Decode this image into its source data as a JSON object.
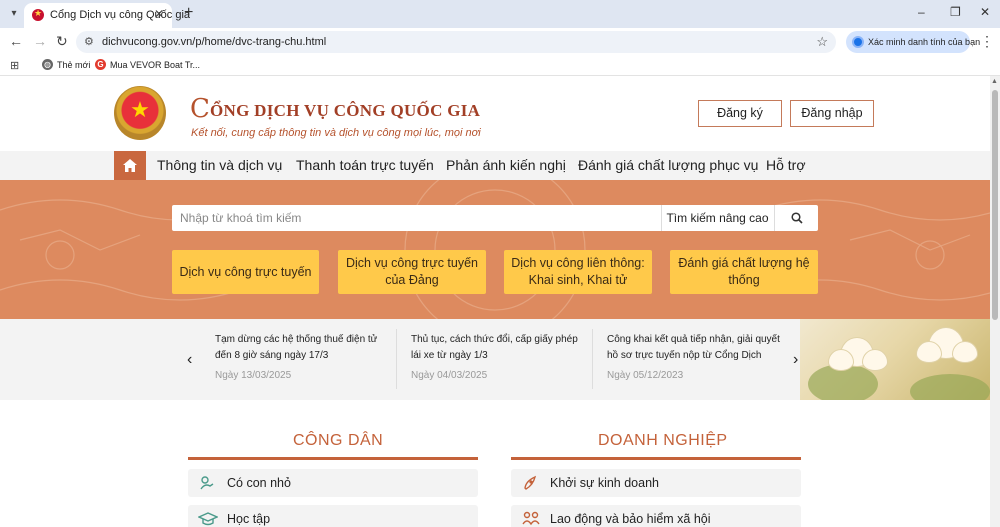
{
  "browser": {
    "tab_title": "Cổng Dịch vụ công Quốc gia",
    "tab_close": "✕",
    "new_tab": "+",
    "url": "dichvucong.gov.vn/p/home/dvc-trang-chu.html",
    "identity_chip": "Xác minh danh tính của bạn",
    "bookmarks": [
      {
        "label": "Thẻ mới",
        "icon": "globe-icon"
      },
      {
        "label": "Mua VEVOR Boat Tr...",
        "icon": "g-icon"
      }
    ],
    "window_controls": [
      "–",
      "❐",
      "✕"
    ]
  },
  "header": {
    "brand_mark": "C",
    "title": "ỔNG DỊCH VỤ CÔNG QUỐC GIA",
    "subtitle": "Kết nối, cung cấp thông tin và dịch vụ công mọi lúc, mọi nơi",
    "register_label": "Đăng ký",
    "login_label": "Đăng nhập"
  },
  "nav": {
    "items": [
      "Thông tin và dịch vụ",
      "Thanh toán trực tuyến",
      "Phản ánh kiến nghị",
      "Đánh giá chất lượng phục vụ",
      "Hỗ trợ"
    ]
  },
  "search": {
    "placeholder": "Nhập từ khoá tìm kiếm",
    "advanced_label": "Tìm kiếm nâng cao"
  },
  "quick_links": [
    "Dịch vụ công trực tuyến",
    "Dịch vụ công trực tuyến của Đảng",
    "Dịch vụ công liên thông: Khai sinh, Khai tử",
    "Đánh giá chất lượng hệ thống"
  ],
  "news": [
    {
      "text": "Tạm dừng các hệ thống thuế điện tử đến 8 giờ sáng ngày 17/3",
      "date": "Ngày 13/03/2025"
    },
    {
      "text": "Thủ tục, cách thức đổi, cấp giấy phép lái xe từ ngày 1/3",
      "date": "Ngày 04/03/2025"
    },
    {
      "text": "Công khai kết quả tiếp nhận, giải quyết hồ sơ trực tuyến nộp từ Cổng Dịch vụ...",
      "date": "Ngày 05/12/2023"
    }
  ],
  "sections": {
    "citizen": {
      "title": "CÔNG DÂN",
      "items": [
        "Có con nhỏ",
        "Học tập"
      ]
    },
    "business": {
      "title": "DOANH NGHIỆP",
      "items": [
        "Khởi sự kinh doanh",
        "Lao động và bảo hiểm xã hội"
      ]
    }
  },
  "colors": {
    "accent": "#c4623a",
    "hero_bg": "#dd8a5f",
    "quick_card": "#ffc94a",
    "brand_red": "#a23f26"
  }
}
